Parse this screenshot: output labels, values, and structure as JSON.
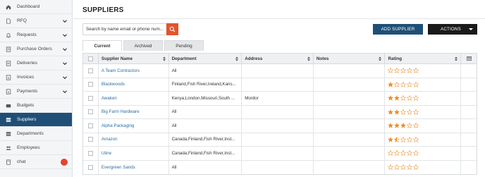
{
  "sidebar": {
    "items": [
      {
        "label": "Dashboard",
        "icon": "home-icon"
      },
      {
        "label": "RFQ",
        "icon": "document-icon",
        "chevron": true
      },
      {
        "label": "Requests",
        "icon": "bell-icon",
        "chevron": true
      },
      {
        "label": "Purchase Orders",
        "icon": "list-icon",
        "chevron": true
      },
      {
        "label": "Deliveries",
        "icon": "truck-icon",
        "chevron": true
      },
      {
        "label": "Invoices",
        "icon": "invoice-icon",
        "chevron": true
      },
      {
        "label": "Payments",
        "icon": "payment-icon",
        "chevron": true
      },
      {
        "label": "Budgets",
        "icon": "budget-icon"
      },
      {
        "label": "Suppliers",
        "icon": "suppliers-icon",
        "active": true
      },
      {
        "label": "Departments",
        "icon": "departments-icon"
      },
      {
        "label": "Employees",
        "icon": "employees-icon"
      },
      {
        "label": "chat",
        "icon": "chat-icon",
        "badge": true
      }
    ]
  },
  "header": {
    "title": "SUPPLIERS"
  },
  "search": {
    "placeholder": "Search by name email or phone num..."
  },
  "toolbar": {
    "add_label": "ADD SUPPLIER",
    "actions_label": "ACTIONS"
  },
  "tabs": [
    {
      "label": "Current",
      "active": true
    },
    {
      "label": "Archived"
    },
    {
      "label": "Pending"
    }
  ],
  "table": {
    "columns": [
      "Supplier Name",
      "Department",
      "Address",
      "Notes",
      "Rating"
    ],
    "rows": [
      {
        "name": "A Team Contractors",
        "department": "All",
        "address": "",
        "notes": "",
        "rating": 0
      },
      {
        "name": "Blackwoods",
        "department": "Finland,Fish River,Ireland,Kans...",
        "address": "",
        "notes": "",
        "rating": 1
      },
      {
        "name": "Awaken",
        "department": "Kenya,London,Missouri,South ...",
        "address": "Mordor",
        "notes": "",
        "rating": 2
      },
      {
        "name": "Big Farm Hardware",
        "department": "All",
        "address": "",
        "notes": "",
        "rating": 2
      },
      {
        "name": "Alpha Packaging",
        "department": "All",
        "address": "",
        "notes": "",
        "rating": 3
      },
      {
        "name": "Amazon",
        "department": "Canada,Finland,Fish River,Inst...",
        "address": "",
        "notes": "",
        "rating": 1.5
      },
      {
        "name": "Uline",
        "department": "Canada,Finland,Fish River,Inst...",
        "address": "",
        "notes": "",
        "rating": 0
      },
      {
        "name": "Evergreen Sands",
        "department": "All",
        "address": "",
        "notes": "",
        "rating": 0
      }
    ]
  },
  "colors": {
    "accent": "#1f4f77",
    "search_button": "#e2542d",
    "star": "#e8912e",
    "badge": "#e2462c"
  }
}
